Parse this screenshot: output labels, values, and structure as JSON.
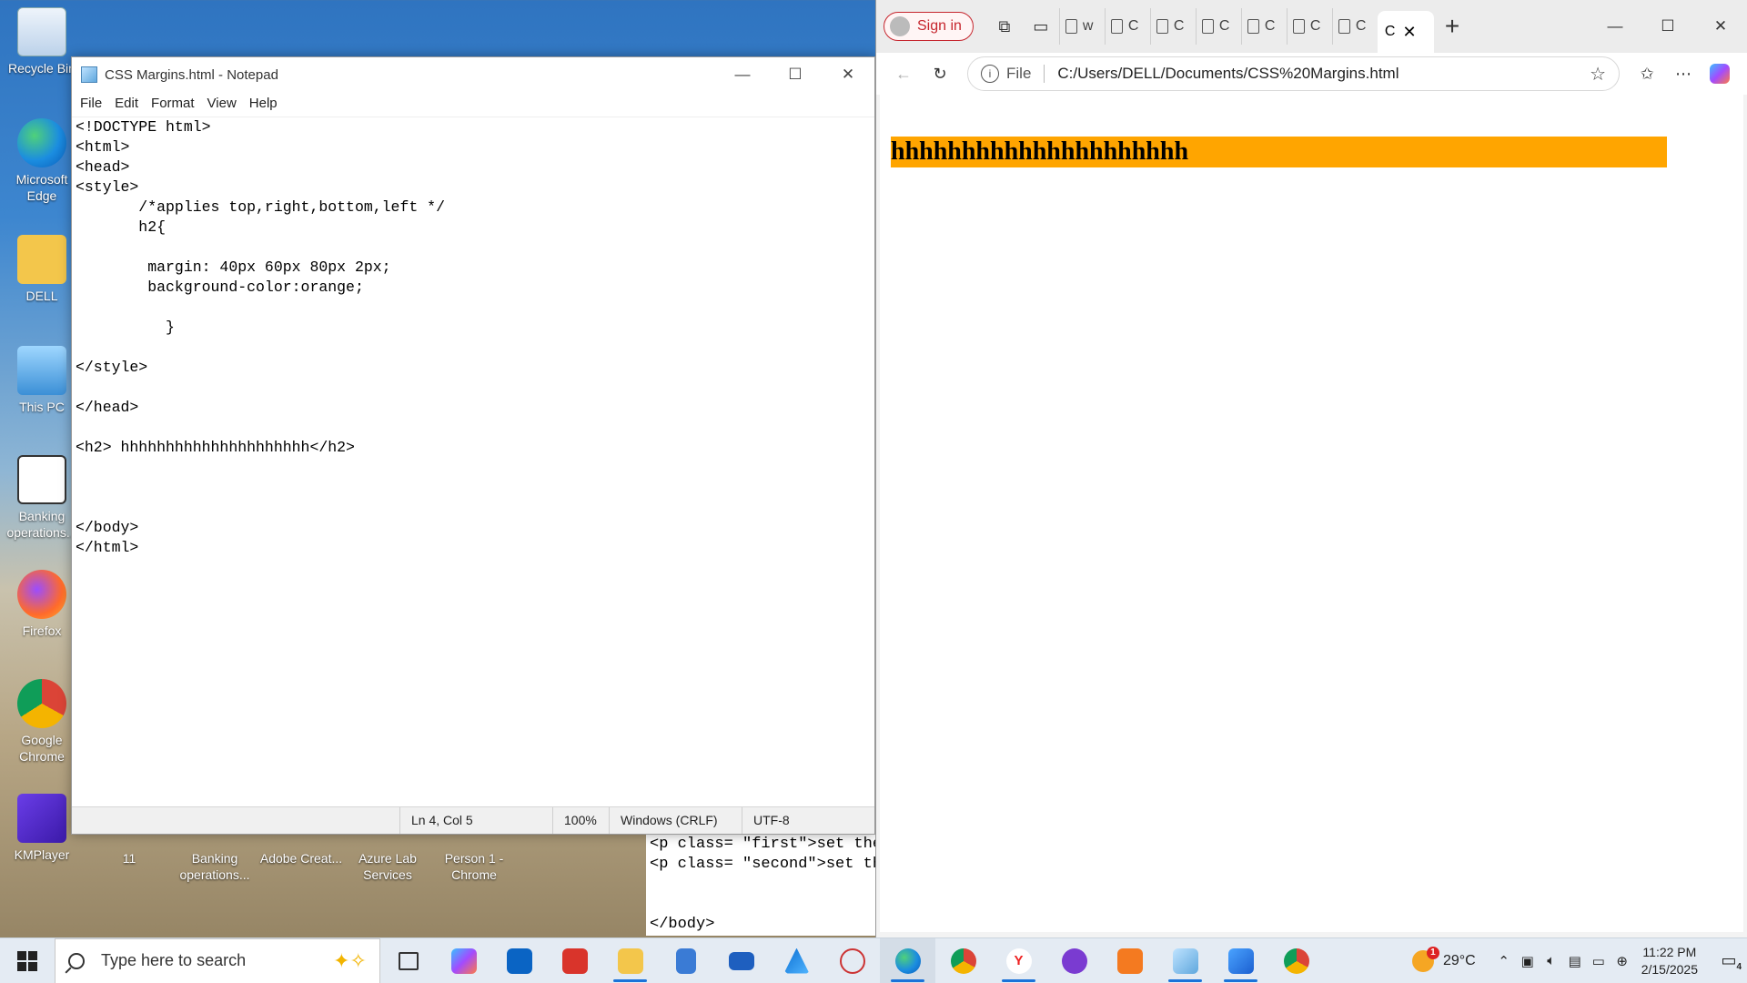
{
  "desktop": {
    "icons": [
      {
        "label": "Recycle Bin",
        "icon": "recycle-bin-icon"
      },
      {
        "label": "Microsoft Edge",
        "icon": "edge-icon"
      },
      {
        "label": "DELL",
        "icon": "user-folder-icon"
      },
      {
        "label": "This PC",
        "icon": "computer-icon"
      },
      {
        "label": "Banking operations...",
        "icon": "vb-document-icon"
      },
      {
        "label": "Firefox",
        "icon": "firefox-icon"
      },
      {
        "label": "Google Chrome",
        "icon": "chrome-icon"
      },
      {
        "label": "KMPlayer",
        "icon": "kmplayer-icon"
      }
    ],
    "bottom_icons": [
      {
        "label": "11",
        "icon": "folder-icon"
      },
      {
        "label": "Banking operations...",
        "icon": "document-icon"
      },
      {
        "label": "Adobe Creat...",
        "icon": "adobe-icon"
      },
      {
        "label": "Azure Lab Services",
        "icon": "azure-icon"
      },
      {
        "label": "Person 1 - Chrome",
        "icon": "chrome-icon"
      }
    ]
  },
  "notepad": {
    "title": "CSS Margins.html - Notepad",
    "menu": [
      "File",
      "Edit",
      "Format",
      "View",
      "Help"
    ],
    "content": "<!DOCTYPE html>\n<html>\n<head>\n<style>\n       /*applies top,right,bottom,left */\n       h2{\n\n        margin: 40px 60px 80px 2px;\n        background-color:orange;\n\n          }\n\n</style>\n\n</head>\n\n<h2> hhhhhhhhhhhhhhhhhhhhh</h2>\n\n\n\n</body>\n</html>",
    "status": {
      "position": "Ln 4, Col 5",
      "zoom": "100%",
      "line_endings": "Windows (CRLF)",
      "encoding": "UTF-8"
    }
  },
  "background_editor": {
    "content": "<p class= \"first\">set the\n<p class= \"second\">set th\n\n\n</body>"
  },
  "browser": {
    "signin_label": "Sign in",
    "tabs": [
      {
        "label": "w"
      },
      {
        "label": "C"
      },
      {
        "label": "C"
      },
      {
        "label": "C"
      },
      {
        "label": "C"
      },
      {
        "label": "C"
      },
      {
        "label": "C"
      },
      {
        "label": "C"
      }
    ],
    "active_tab_label": "C",
    "address": {
      "scheme_label": "File",
      "url": "C:/Users/DELL/Documents/CSS%20Margins.html"
    },
    "page": {
      "h2_text": "hhhhhhhhhhhhhhhhhhhhh",
      "h2_background": "#ffa500"
    }
  },
  "taskbar": {
    "search_placeholder": "Type here to search",
    "apps": [
      "task-view-icon",
      "copilot-icon",
      "outlook-icon",
      "pinned-red-app-icon",
      "file-explorer-icon",
      "calculator-icon",
      "mail-icon",
      "azure-icon",
      "snipping-tool-icon",
      "edge-icon",
      "chrome-icon",
      "yandex-icon",
      "game-app-icon",
      "xampp-icon",
      "notepad-icon",
      "photos-icon",
      "chrome-icon"
    ],
    "weather": {
      "temp": "29°C",
      "badge": "1"
    },
    "clock": {
      "time": "11:22 PM",
      "date": "2/15/2025"
    },
    "notifications": "4"
  },
  "colors": {
    "accent": "#1a73d9",
    "signin": "#c6262e",
    "heading_bg": "#ffa500"
  }
}
